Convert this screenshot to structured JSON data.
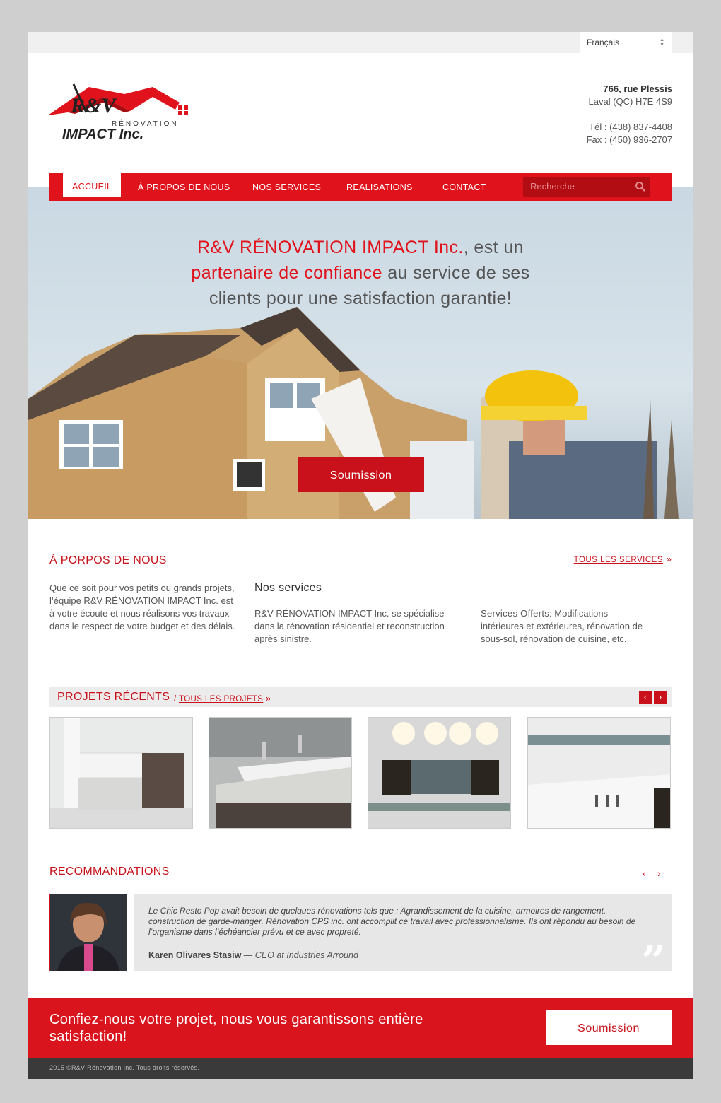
{
  "language": {
    "selected": "Français"
  },
  "logo": {
    "line1": "R&V",
    "line2": "RÉNOVATION",
    "line3": "IMPACT Inc."
  },
  "contact": {
    "street": "766, rue Plessis",
    "city": "Laval (QC) H7E 4S9",
    "phone": "Tél : (438) 837-4408",
    "fax": "Fax : (450) 936-2707"
  },
  "nav": {
    "items": [
      "ACCUEIL",
      "À PROPOS DE NOUS",
      "NOS SERVICES",
      "REALISATIONS",
      "CONTACT"
    ],
    "search_placeholder": "Recherche"
  },
  "hero": {
    "l1_red": "R&V RÉNOVATION IMPACT Inc.",
    "l1_rest": ", est un",
    "l2_red": "partenaire de confiance",
    "l2_rest": " au service de ses",
    "l3": "clients pour une satisfaction garantie!",
    "button": "Soumission"
  },
  "about": {
    "title": "Á PORPOS DE NOUS",
    "all_services": "TOUS LES SERVICES",
    "col1": "Que ce soit pour vos petits ou grands projets, l’équipe R&V RÉNOVATION IMPACT Inc. est à votre écoute et nous réalisons vos travaux dans le respect de votre budget et des délais.",
    "col2_title": "Nos services",
    "col2": "R&V RÉNOVATION IMPACT  Inc. se spécialise dans la rénovation résidentiel et reconstruction après sinistre.",
    "col3_head": "Services Offerts",
    "col3": ": Modifications intérieures et extérieures, rénovation de sous-sol, rénovation de cuisine, etc."
  },
  "projects": {
    "title": "PROJETS RÉCENTS",
    "sep": "/ ",
    "all_link": "TOUS LES PROJETS",
    "prev": "‹",
    "next": "›"
  },
  "recommendations": {
    "title": "RECOMMANDATIONS",
    "quote": "Le Chic Resto Pop avait besoin de quelques rénovations tels que : Agrandissement de la cuisine, armoires de rangement, construction de garde-manger. Rénovation CPS inc. ont accomplit ce travail avec professionnalisme. Ils ont répondu au besoin de l’organisme dans l’échéancier prévu et ce avec propreté.",
    "author": "Karen Olivares Stasiw",
    "role": " — CEO at Industries Arround"
  },
  "cta": {
    "text": "Confiez-nous votre projet, nous vous garantissons entière satisfaction!",
    "button": "Soumission"
  },
  "footer": {
    "text": "2015 ©R&V Rénovation Inc. Tous droits réservés."
  },
  "colors": {
    "brand_red": "#e0121b",
    "dark_red": "#c8111a",
    "footer": "#3a3a3a"
  }
}
